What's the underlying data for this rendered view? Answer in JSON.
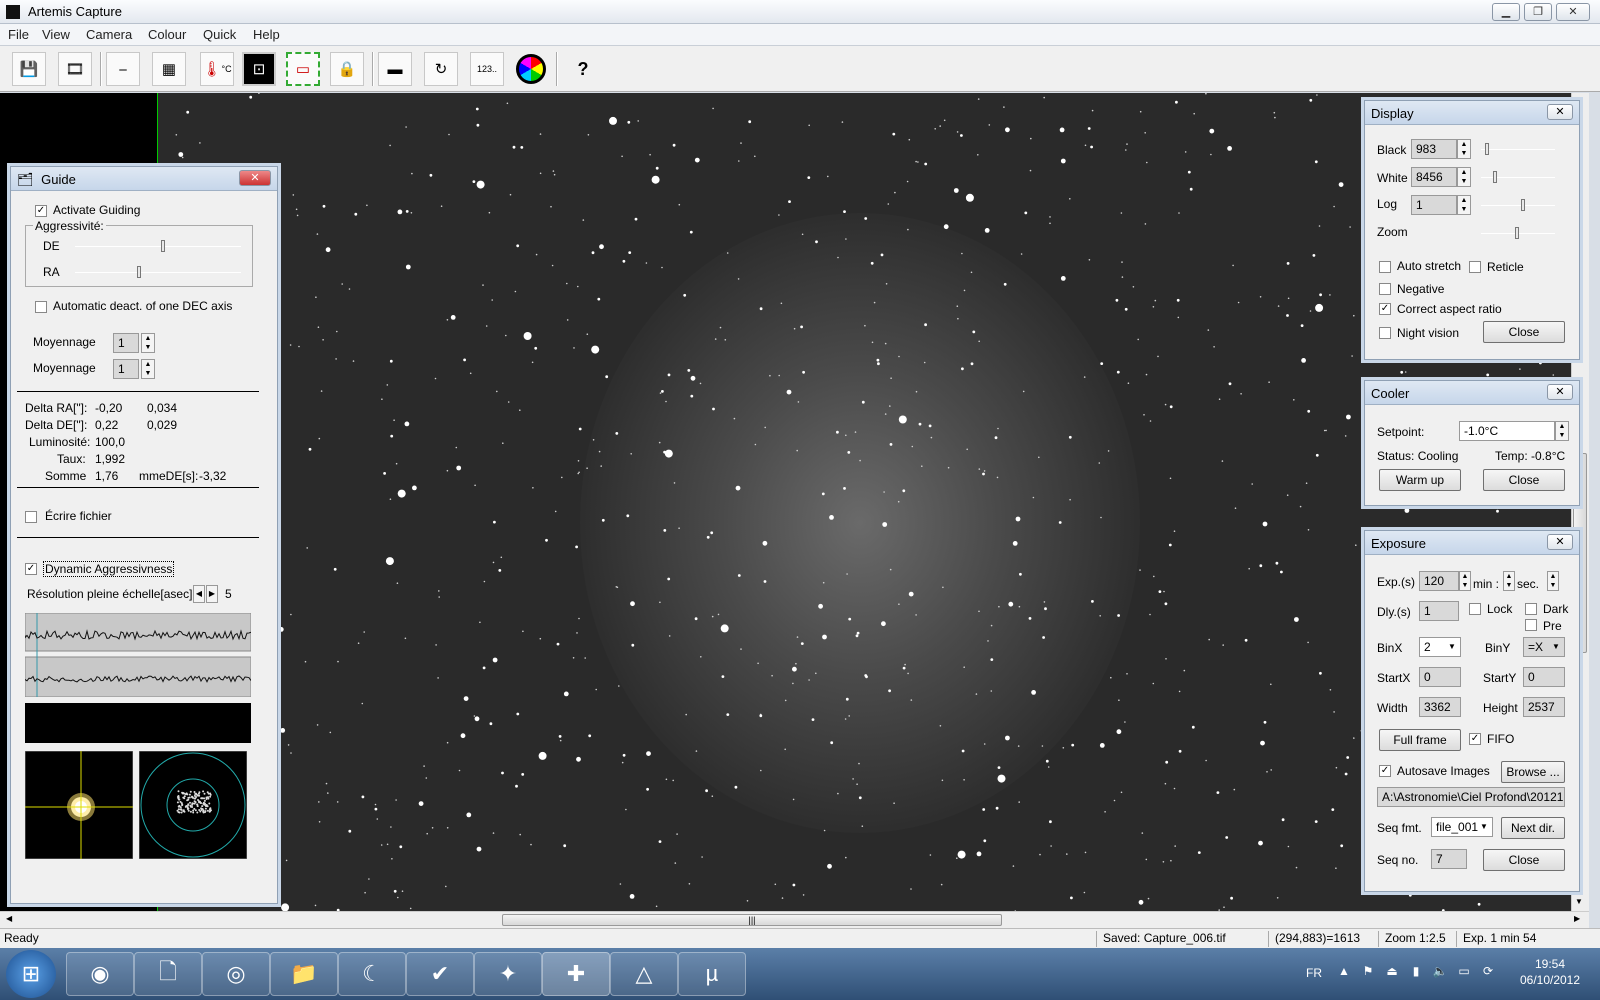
{
  "window": {
    "title": "Artemis Capture",
    "min": "▁",
    "max": "❐",
    "close": "✕"
  },
  "menu": [
    "File",
    "View",
    "Camera",
    "Colour",
    "Quick",
    "Help"
  ],
  "toolbar": {
    "temp_label": "°C",
    "seq_label": "123..",
    "help": "?"
  },
  "guide": {
    "title": "Guide",
    "activate": "Activate Guiding",
    "aggressivite": "Aggressivité:",
    "de": "DE",
    "ra": "RA",
    "auto_deact": "Automatic deact. of one DEC axis",
    "moyennage1": "Moyennage",
    "moyennage1_val": "1",
    "moyennage2": "Moyennage",
    "moyennage2_val": "1",
    "stats": [
      {
        "label": "Delta RA[\"]:",
        "v1": "-0,20",
        "v2": "0,034"
      },
      {
        "label": "Delta DE[\"]:",
        "v1": "0,22",
        "v2": "0,029"
      },
      {
        "label": "Luminosité:",
        "v1": "100,0",
        "v2": ""
      },
      {
        "label": "Taux:",
        "v1": "1,992",
        "v2": ""
      },
      {
        "label": "Somme",
        "v1": "1,76",
        "v2": "mmeDE[s]:"
      }
    ],
    "somme_de_val": "-3,32",
    "ecrire": "Écrire fichier",
    "dynamic": "Dynamic Aggressivness",
    "resolution": "Résolution pleine échelle[asec]:",
    "resolution_val": "5"
  },
  "display": {
    "title": "Display",
    "black": "Black",
    "black_val": "983",
    "white": "White",
    "white_val": "8456",
    "log": "Log",
    "log_val": "1",
    "zoom": "Zoom",
    "auto_stretch": "Auto stretch",
    "reticle": "Reticle",
    "negative": "Negative",
    "correct_aspect": "Correct aspect ratio",
    "night_vision": "Night vision",
    "close": "Close"
  },
  "cooler": {
    "title": "Cooler",
    "setpoint": "Setpoint:",
    "setpoint_val": "-1.0°C",
    "status": "Status: Cooling",
    "temp": "Temp: -0.8°C",
    "warm": "Warm up",
    "close": "Close"
  },
  "exposure": {
    "title": "Exposure",
    "exp": "Exp.(s)",
    "exp_val": "120",
    "min": "min :",
    "sec": "sec.",
    "dly": "Dly.(s)",
    "dly_val": "1",
    "lock": "Lock",
    "dark": "Dark",
    "pre": "Pre",
    "binx": "BinX",
    "binx_val": "2",
    "biny": "BinY",
    "biny_val": "=X",
    "startx": "StartX",
    "startx_val": "0",
    "starty": "StartY",
    "starty_val": "0",
    "width": "Width",
    "width_val": "3362",
    "height": "Height",
    "height_val": "2537",
    "fullframe": "Full frame",
    "fifo": "FIFO",
    "autosave": "Autosave Images",
    "browse": "Browse ...",
    "path": "A:\\Astronomie\\Ciel Profond\\20121",
    "seqfmt": "Seq fmt.",
    "seqfmt_val": "file_001",
    "nextdir": "Next dir.",
    "seqno": "Seq no.",
    "seqno_val": "7",
    "close": "Close"
  },
  "status": {
    "ready": "Ready",
    "saved": "Saved: Capture_006.tif",
    "coord": "(294,883)=1613",
    "zoom": "Zoom 1:2.5",
    "exp": "Exp. 1 min 54"
  },
  "taskbar": {
    "lang": "FR",
    "time": "19:54",
    "date": "06/10/2012"
  },
  "colors": {
    "panel_title": "#c6d6ea",
    "image_bg": "#2a2a2a",
    "taskbar": "#2f4f75"
  }
}
